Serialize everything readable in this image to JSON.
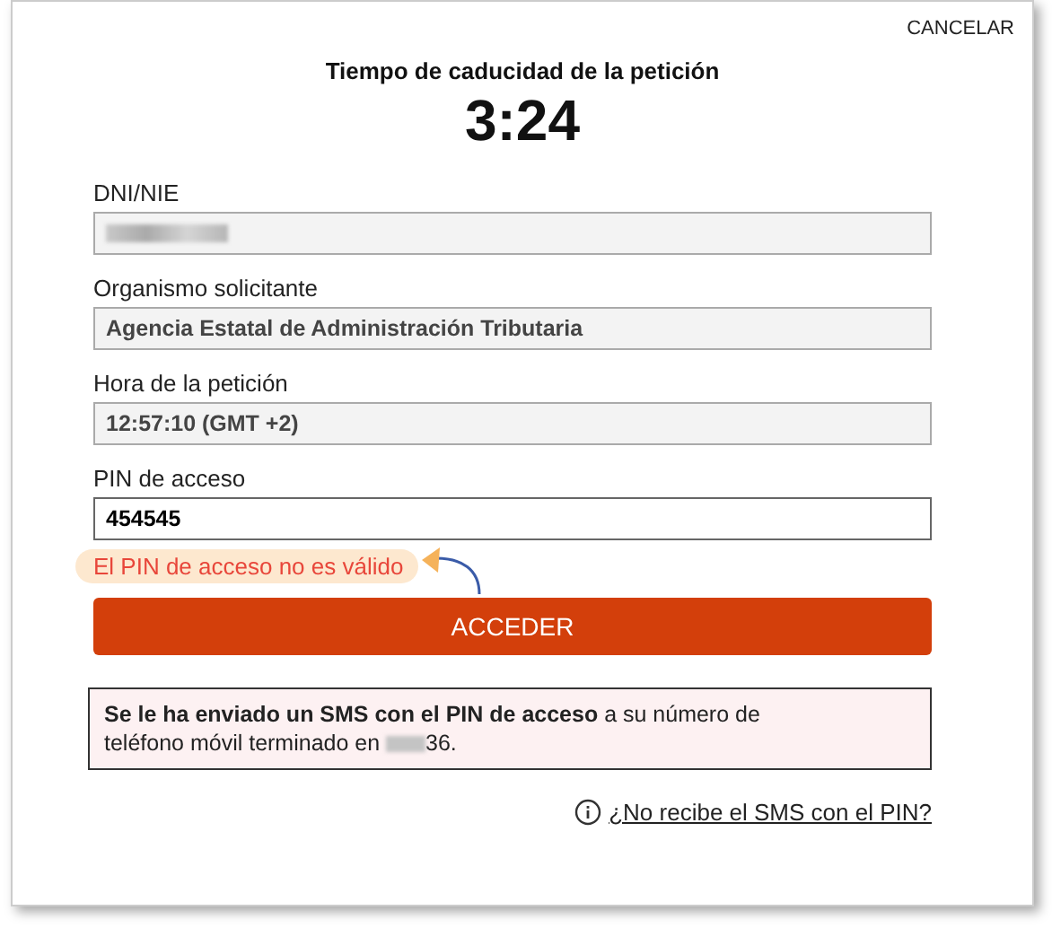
{
  "cancel": "CANCELAR",
  "timer": {
    "title": "Tiempo de caducidad de la petición",
    "time": "3:24"
  },
  "fields": [
    {
      "label": "DNI/NIE",
      "kind": "redacted"
    },
    {
      "label": "Organismo solicitante",
      "kind": "readonly",
      "value": "Agencia Estatal de Administración Tributaria"
    },
    {
      "label": "Hora de la petición",
      "kind": "readonly",
      "value": "12:57:10 (GMT +2)"
    },
    {
      "label": "PIN de acceso",
      "kind": "input",
      "value": "454545"
    }
  ],
  "error": {
    "text": "El PIN de acceso no es válido",
    "highlighted": true
  },
  "submit": "ACCEDER",
  "notice": {
    "bold": "Se le ha enviado un SMS con el PIN de acceso",
    "text": "a su número de teléfono móvil terminado en",
    "suffix": "36."
  },
  "help_link": "¿No recibe el SMS con el PIN?"
}
